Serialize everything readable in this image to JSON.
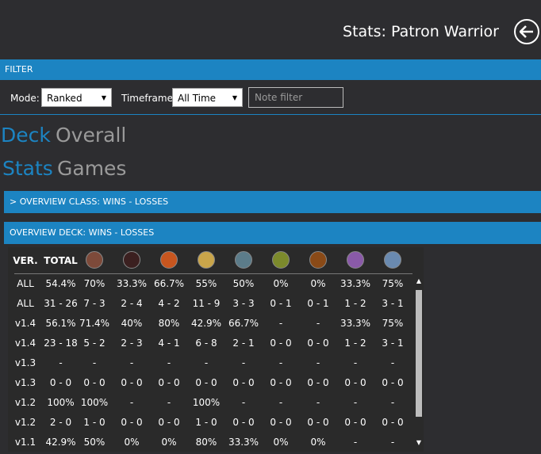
{
  "header": {
    "title": "Stats: Patron Warrior"
  },
  "filter": {
    "section_label": "FILTER",
    "mode_label": "Mode:",
    "mode_value": "Ranked",
    "timeframe_label": "Timeframe:",
    "timeframe_value": "All Time",
    "note_placeholder": "Note filter"
  },
  "tabs": {
    "row1": [
      "Deck",
      "Overall"
    ],
    "row2": [
      "Stats",
      "Games"
    ]
  },
  "sections": {
    "overview_class": "> OVERVIEW CLASS:  WINS - LOSSES",
    "overview_deck": "OVERVIEW DECK:  WINS - LOSSES"
  },
  "table": {
    "headers": [
      "VER.",
      "TOTAL"
    ],
    "class_icons": [
      "warrior-icon",
      "rogue-icon",
      "mage-icon",
      "paladin-icon",
      "shaman-icon",
      "druid-icon",
      "warlock-icon",
      "priest-icon",
      "hunter-icon"
    ],
    "rows": [
      [
        "ALL",
        "54.4%",
        "70%",
        "33.3%",
        "66.7%",
        "55%",
        "50%",
        "0%",
        "0%",
        "33.3%",
        "75%"
      ],
      [
        "ALL",
        "31 - 26",
        "7 - 3",
        "2 - 4",
        "4 - 2",
        "11 - 9",
        "3 - 3",
        "0 - 1",
        "0 - 1",
        "1 - 2",
        "3 - 1"
      ],
      [
        "v1.4",
        "56.1%",
        "71.4%",
        "40%",
        "80%",
        "42.9%",
        "66.7%",
        "-",
        "-",
        "33.3%",
        "75%"
      ],
      [
        "v1.4",
        "23 - 18",
        "5 - 2",
        "2 - 3",
        "4 - 1",
        "6 - 8",
        "2 - 1",
        "0 - 0",
        "0 - 0",
        "1 - 2",
        "3 - 1"
      ],
      [
        "v1.3",
        "-",
        "-",
        "-",
        "-",
        "-",
        "-",
        "-",
        "-",
        "-",
        "-"
      ],
      [
        "v1.3",
        "0 - 0",
        "0 - 0",
        "0 - 0",
        "0 - 0",
        "0 - 0",
        "0 - 0",
        "0 - 0",
        "0 - 0",
        "0 - 0",
        "0 - 0"
      ],
      [
        "v1.2",
        "100%",
        "100%",
        "-",
        "-",
        "100%",
        "-",
        "-",
        "-",
        "-",
        "-"
      ],
      [
        "v1.2",
        "2 - 0",
        "1 - 0",
        "0 - 0",
        "0 - 0",
        "1 - 0",
        "0 - 0",
        "0 - 0",
        "0 - 0",
        "0 - 0",
        "0 - 0"
      ],
      [
        "v1.1",
        "42.9%",
        "50%",
        "0%",
        "0%",
        "80%",
        "33.3%",
        "0%",
        "0%",
        "-",
        "-"
      ]
    ]
  },
  "colors": {
    "accent": "#1c84c2",
    "background": "#2d2d30"
  }
}
